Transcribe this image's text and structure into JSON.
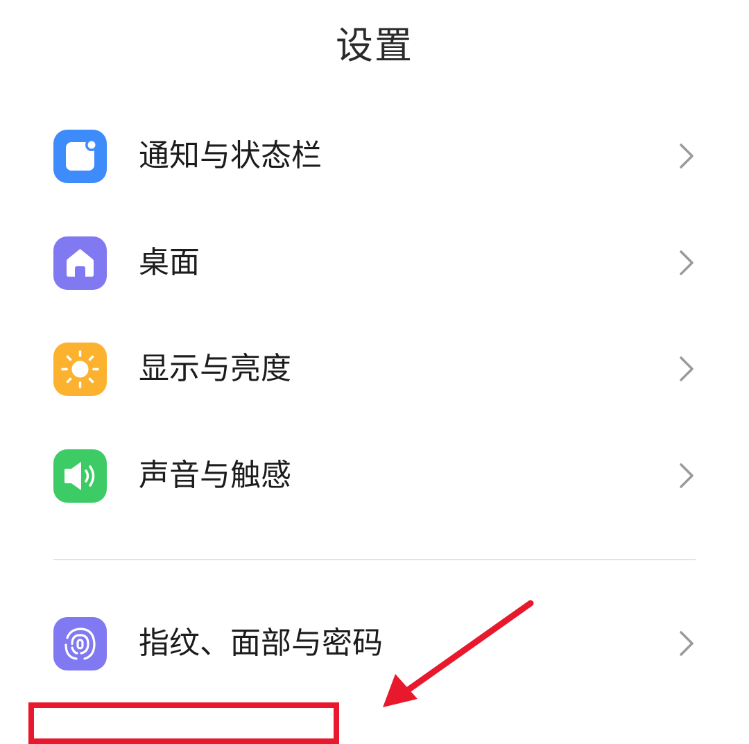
{
  "header": {
    "title": "设置"
  },
  "settings": {
    "items": [
      {
        "label": "通知与状态栏",
        "icon": "notification-icon",
        "color": "#3E8BFB"
      },
      {
        "label": "桌面",
        "icon": "home-icon",
        "color": "#8079F2"
      },
      {
        "label": "显示与亮度",
        "icon": "sun-icon",
        "color": "#FDB22F"
      },
      {
        "label": "声音与触感",
        "icon": "speaker-icon",
        "color": "#3CCB64"
      },
      {
        "label": "指纹、面部与密码",
        "icon": "fingerprint-icon",
        "color": "#8079F2"
      }
    ]
  },
  "annotation": {
    "color": "#E8192C"
  }
}
